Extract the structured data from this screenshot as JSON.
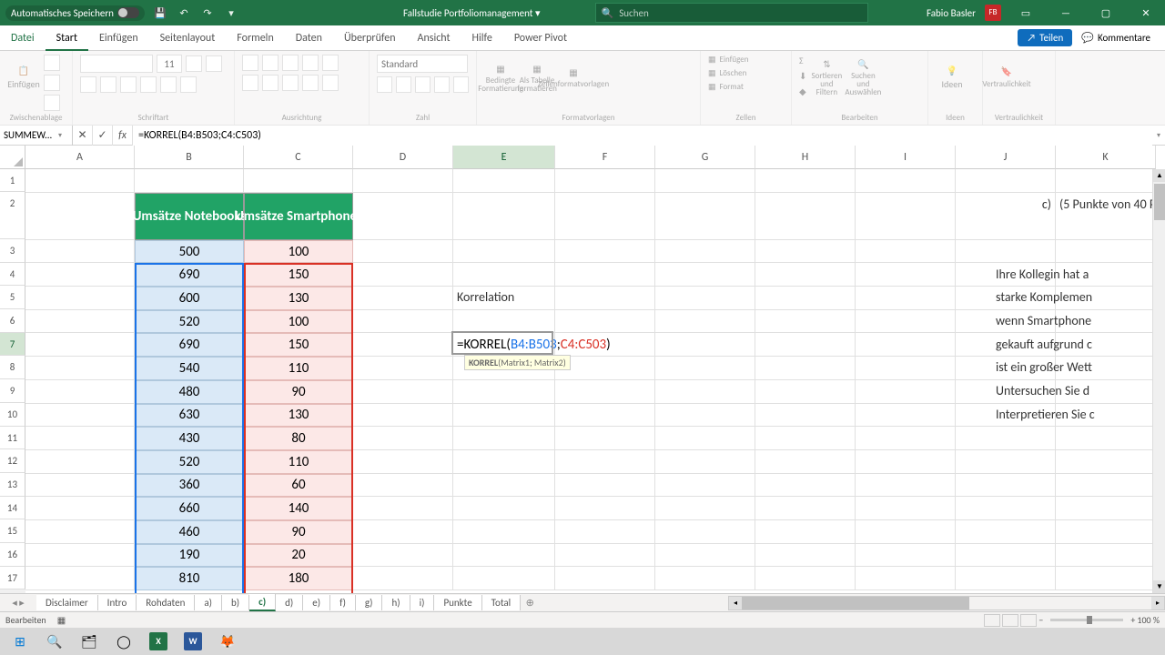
{
  "titlebar": {
    "autosave_label": "Automatisches Speichern",
    "filename": "Fallstudie Portfoliomanagement",
    "search_placeholder": "Suchen",
    "user_name": "Fabio Basler",
    "user_initials": "FB"
  },
  "tabs": {
    "file": "Datei",
    "home": "Start",
    "insert": "Einfügen",
    "pagelayout": "Seitenlayout",
    "formulas": "Formeln",
    "data": "Daten",
    "review": "Überprüfen",
    "view": "Ansicht",
    "help": "Hilfe",
    "powerpivot": "Power Pivot",
    "share": "Teilen",
    "comments": "Kommentare"
  },
  "ribbon": {
    "clipboard": "Zwischenablage",
    "paste": "Einfügen",
    "font_group": "Schriftart",
    "font_size": "11",
    "alignment": "Ausrichtung",
    "number_format_label": "Standard",
    "number": "Zahl",
    "styles": "Formatvorlagen",
    "cond_format": "Bedingte Formatierung",
    "as_table": "Als Tabelle formatieren",
    "cell_styles": "Zellenformatvorlagen",
    "cells": "Zellen",
    "insert_cells": "Einfügen",
    "delete_cells": "Löschen",
    "format_cells": "Format",
    "editing": "Bearbeiten",
    "sort_filter": "Sortieren und Filtern",
    "find_select": "Suchen und Auswählen",
    "ideas_group": "Ideen",
    "ideas_btn": "Ideen",
    "sensitivity_group": "Vertraulichkeit",
    "sensitivity_btn": "Vertraulichkeit"
  },
  "fx": {
    "name_box": "SUMMEW...",
    "formula": "=KORREL(B4:B503;C4:C503)"
  },
  "columns": [
    "A",
    "B",
    "C",
    "D",
    "E",
    "F",
    "G",
    "H",
    "I",
    "J",
    "K"
  ],
  "rows": [
    "1",
    "2",
    "3",
    "4",
    "5",
    "6",
    "7",
    "8",
    "9",
    "10",
    "11",
    "12",
    "13",
    "14",
    "15",
    "16",
    "17"
  ],
  "table": {
    "hdr_b": "Umsätze Notebooks",
    "hdr_c": "Umsätze Smartphones",
    "data": [
      {
        "b": "500",
        "c": "100"
      },
      {
        "b": "690",
        "c": "150"
      },
      {
        "b": "600",
        "c": "130"
      },
      {
        "b": "520",
        "c": "100"
      },
      {
        "b": "690",
        "c": "150"
      },
      {
        "b": "540",
        "c": "110"
      },
      {
        "b": "480",
        "c": "90"
      },
      {
        "b": "630",
        "c": "130"
      },
      {
        "b": "430",
        "c": "80"
      },
      {
        "b": "520",
        "c": "110"
      },
      {
        "b": "360",
        "c": "60"
      },
      {
        "b": "660",
        "c": "140"
      },
      {
        "b": "460",
        "c": "90"
      },
      {
        "b": "190",
        "c": "20"
      },
      {
        "b": "810",
        "c": "180"
      }
    ]
  },
  "content": {
    "korrelation_label": "Korrelation",
    "active_formula_prefix": "=KORREL(",
    "active_formula_arg1": "B4:B503",
    "active_formula_sep": ";",
    "active_formula_arg2": "C4:C503",
    "active_formula_suffix": ")",
    "tooltip_fn": "KORREL",
    "tooltip_args": "(Matrix1; Matrix2)",
    "question_label": "c)",
    "question_points": "(5 Punkte von 40 P",
    "p1": "Ihre Kollegin hat a",
    "p2": "starke Komplemen",
    "p3": "wenn Smartphone",
    "p4": "gekauft aufgrund c",
    "p5": "ist ein großer Wett",
    "p6": "Untersuchen Sie d",
    "p7": "Interpretieren Sie c"
  },
  "sheets": [
    "Disclaimer",
    "Intro",
    "Rohdaten",
    "a)",
    "b)",
    "c)",
    "d)",
    "e)",
    "f)",
    "g)",
    "h)",
    "i)",
    "Punkte",
    "Total"
  ],
  "active_sheet": "c)",
  "status": {
    "mode": "Bearbeiten",
    "zoom": "100 %"
  }
}
